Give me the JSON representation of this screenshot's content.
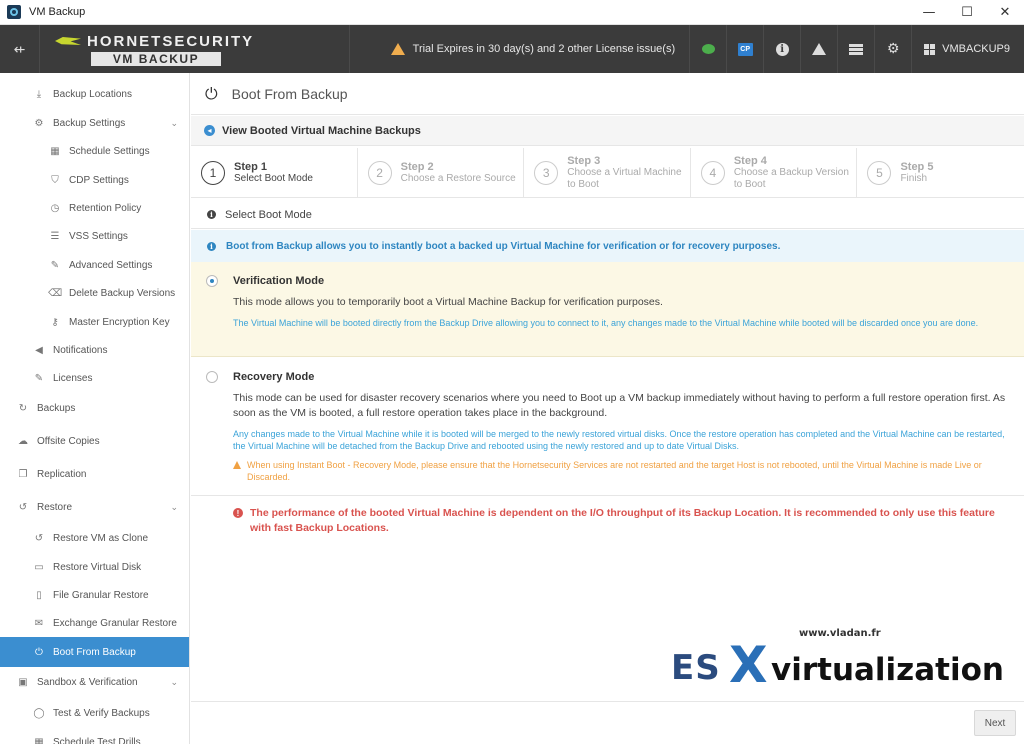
{
  "window": {
    "title": "VM Backup",
    "minimize": "—",
    "maximize": "☐",
    "close": "✕"
  },
  "header": {
    "brand": "HORNETSECURITY",
    "product": "VM BACKUP",
    "trial_text": "Trial Expires in 30 day(s) and 2 other License issue(s)",
    "cp_label": "CP",
    "host": "VMBACKUP9",
    "menu_glyph": "⇷",
    "info_glyph": "i",
    "settings_glyph": "⚙"
  },
  "sidebar": {
    "items": [
      {
        "label": "Backup Locations",
        "icon": "⤓",
        "level": 1
      },
      {
        "label": "Backup Settings",
        "icon": "⚙",
        "level": 1,
        "chev": "⌄"
      },
      {
        "label": "Schedule Settings",
        "icon": "▦",
        "level": 2
      },
      {
        "label": "CDP Settings",
        "icon": "⛉",
        "level": 2
      },
      {
        "label": "Retention Policy",
        "icon": "◷",
        "level": 2
      },
      {
        "label": "VSS Settings",
        "icon": "☰",
        "level": 2
      },
      {
        "label": "Advanced Settings",
        "icon": "✎",
        "level": 2
      },
      {
        "label": "Delete Backup Versions",
        "icon": "⌫",
        "level": 2
      },
      {
        "label": "Master Encryption Key",
        "icon": "⚷",
        "level": 2
      },
      {
        "label": "Notifications",
        "icon": "◀",
        "level": 1
      },
      {
        "label": "Licenses",
        "icon": "✎",
        "level": 1
      },
      {
        "label": "Backups",
        "icon": "↻",
        "level": 0
      },
      {
        "label": "Offsite Copies",
        "icon": "☁",
        "level": 0
      },
      {
        "label": "Replication",
        "icon": "❐",
        "level": 0
      },
      {
        "label": "Restore",
        "icon": "↺",
        "level": 0,
        "chev": "⌄"
      },
      {
        "label": "Restore VM as Clone",
        "icon": "↺",
        "level": 1
      },
      {
        "label": "Restore Virtual Disk",
        "icon": "▭",
        "level": 1
      },
      {
        "label": "File Granular Restore",
        "icon": "▯",
        "level": 1
      },
      {
        "label": "Exchange Granular Restore",
        "icon": "✉",
        "level": 1
      },
      {
        "label": "Boot From Backup",
        "icon": "⏻",
        "level": 1,
        "active": true
      },
      {
        "label": "Sandbox & Verification",
        "icon": "▣",
        "level": 0,
        "chev": "⌄"
      },
      {
        "label": "Test & Verify Backups",
        "icon": "◯",
        "level": 1
      },
      {
        "label": "Schedule Test Drills",
        "icon": "▦",
        "level": 1
      }
    ]
  },
  "main": {
    "power_glyph": "⏻",
    "page_title": "Boot From Backup",
    "view_booted": "View Booted Virtual Machine Backups",
    "view_booted_arrow": "◂",
    "steps": [
      {
        "num": "1",
        "title": "Step 1",
        "desc": "Select Boot Mode",
        "current": true
      },
      {
        "num": "2",
        "title": "Step 2",
        "desc": "Choose a Restore Source"
      },
      {
        "num": "3",
        "title": "Step 3",
        "desc": "Choose a Virtual Machine to Boot"
      },
      {
        "num": "4",
        "title": "Step 4",
        "desc": "Choose a Backup Version to Boot"
      },
      {
        "num": "5",
        "title": "Step 5",
        "desc": "Finish"
      }
    ],
    "section_heading": "Select Boot Mode",
    "info_glyph": "i",
    "info_text": "Boot from Backup allows you to instantly boot a backed up Virtual Machine for verification or for recovery purposes.",
    "modes": {
      "verification": {
        "title": "Verification Mode",
        "desc": "This mode allows you to temporarily boot a Virtual Machine Backup for verification purposes.",
        "note": "The Virtual Machine will be booted directly from the Backup Drive allowing you to connect to it, any changes made to the Virtual Machine while booted will be discarded once you are done.",
        "selected": true
      },
      "recovery": {
        "title": "Recovery Mode",
        "desc": "This mode can be used for disaster recovery scenarios where you need to Boot up a VM backup immediately without having to perform a full restore operation first. As soon as the VM is booted, a full restore operation takes place in the background.",
        "note": "Any changes made to the Virtual Machine while it is booted will be merged to the newly restored virtual disks. Once the restore operation has completed and the Virtual Machine can be restarted, the Virtual Machine will be detached from the Backup Drive and rebooted using the newly restored and up to date Virtual Disks.",
        "warning": "When using Instant Boot - Recovery Mode, please ensure that the Hornetsecurity Services are not restarted and the target Host is not rebooted, until the Virtual Machine is made Live or Discarded.",
        "selected": false
      }
    },
    "performance_glyph": "!",
    "performance_warning": "The performance of the booted Virtual Machine is dependent on the I/O throughput of its Backup Location. It is recommended to only use this feature with fast Backup Locations.",
    "next_label": "Next"
  },
  "watermark": {
    "url": "www.vladan.fr",
    "es": "ES",
    "x": "X",
    "virt": "virtualization"
  },
  "colors": {
    "accent": "#3b8ed0",
    "header_bg": "#3b3b3b",
    "warning": "#f0ad4e",
    "error": "#d9534f",
    "verify_bg": "#fcf8e5"
  }
}
